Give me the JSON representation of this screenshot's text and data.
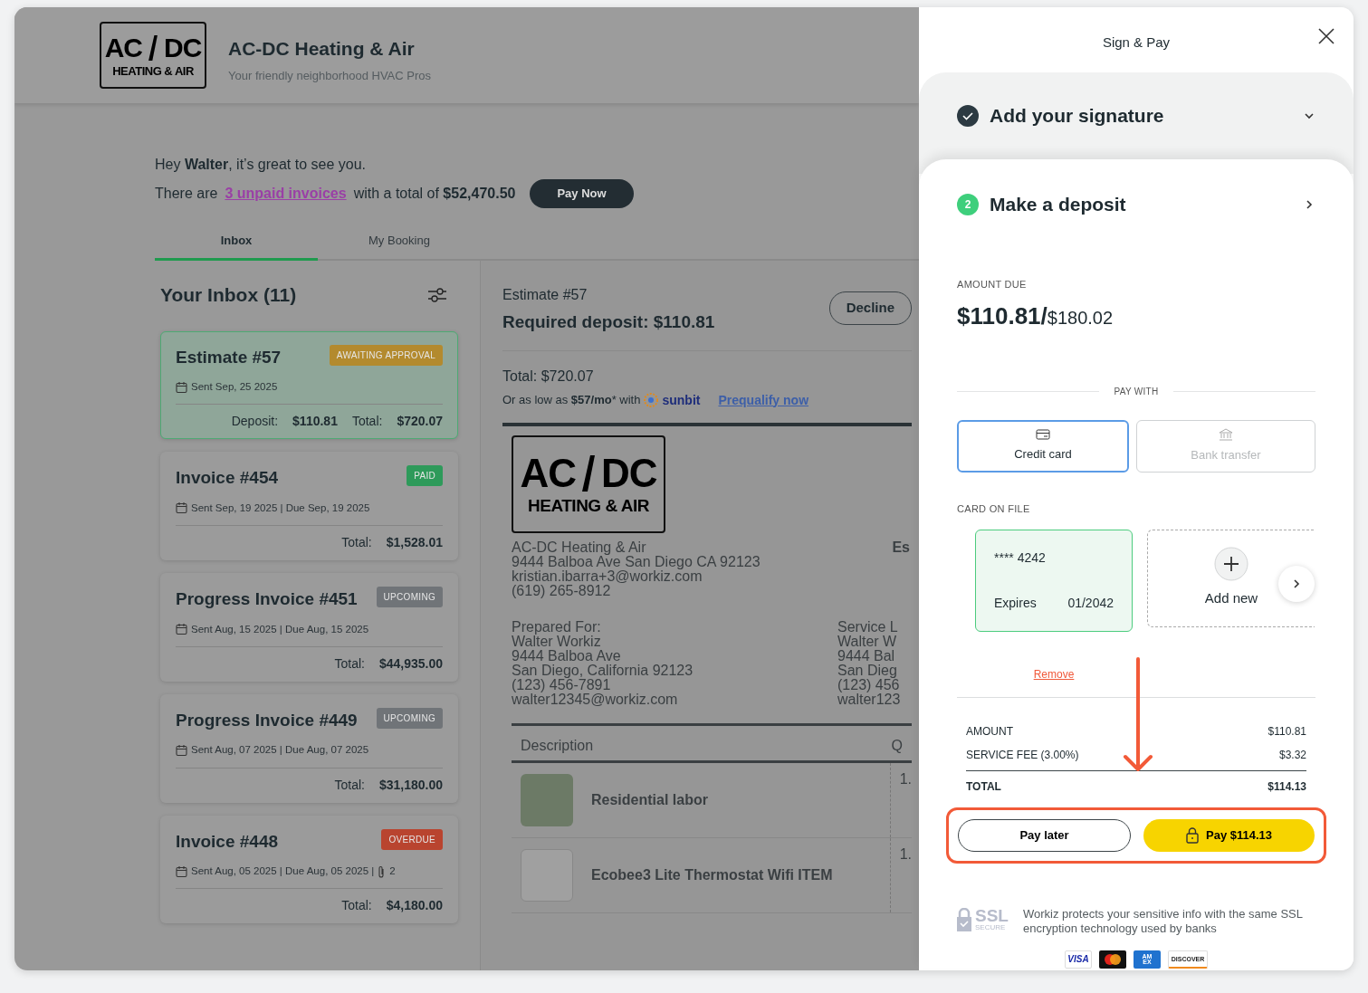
{
  "company": {
    "logo": {
      "left": "AC",
      "right": "DC",
      "tagline": "HEATING & AIR"
    },
    "name": "AC-DC Heating & Air",
    "slogan": "Your friendly neighborhood HVAC Pros"
  },
  "greeting": {
    "line": "Hey **Walter**, it’s great to see you.",
    "prefix": "There are",
    "unpaid_link": "3 unpaid invoices",
    "suffix": "with a total of **$52,470.50**",
    "button": "Pay Now"
  },
  "tabs": [
    {
      "label": "Inbox",
      "selected": true
    },
    {
      "label": "My Booking",
      "selected": false
    }
  ],
  "inbox": {
    "title": "Your Inbox (11)",
    "items": [
      {
        "title": "Estimate #57",
        "status": "AWAITING APPROVAL",
        "color": "#b38a2e",
        "selected": true,
        "meta": "Sent Sep, 25 2025",
        "totals": [
          {
            "label": "Deposit:",
            "value": "$110.81"
          },
          {
            "label": "Total:",
            "value": "$720.07"
          }
        ]
      },
      {
        "title": "Invoice #454",
        "status": "PAID",
        "color": "#2e9a5a",
        "selected": false,
        "meta": "Sent Sep, 19 2025 | Due Sep, 19 2025",
        "totals": [
          {
            "label": "Total:",
            "value": "$1,528.01"
          }
        ]
      },
      {
        "title": "Progress Invoice #451",
        "status": "UPCOMING",
        "color": "#707478",
        "selected": false,
        "meta": "Sent Aug, 15 2025 | Due Aug, 15 2025",
        "totals": [
          {
            "label": "Total:",
            "value": "$44,935.00"
          }
        ]
      },
      {
        "title": "Progress Invoice #449",
        "status": "UPCOMING",
        "color": "#707478",
        "selected": false,
        "meta": "Sent Aug, 07 2025 | Due Aug, 07 2025",
        "totals": [
          {
            "label": "Total:",
            "value": "$31,180.00"
          }
        ]
      },
      {
        "title": "Invoice #448",
        "status": "OVERDUE",
        "color": "#b9442f",
        "selected": false,
        "meta": "Sent Aug, 05 2025 | Due Aug, 05 2025 |",
        "attachments": "2",
        "totals": [
          {
            "label": "Total:",
            "value": "$4,180.00"
          }
        ]
      }
    ]
  },
  "estimate": {
    "number": "Estimate #57",
    "deposit": "Required deposit: $110.81",
    "decline": "Decline",
    "total": "Total: $720.07",
    "financing": "Or as low as **$57/mo*** with",
    "financer": "sunbit",
    "prequalify": "Prequalify now",
    "document": {
      "logo": {
        "left": "AC",
        "right": "DC",
        "tagline": "HEATING & AIR"
      },
      "company_lines": [
        "AC-DC Heating & Air",
        "9444 Balboa Ave San Diego CA 92123",
        "kristian.ibarra+3@workiz.com",
        "(619) 265-8912"
      ],
      "side_label": "Es",
      "prepared_for": {
        "title": "Prepared For:",
        "lines": [
          "Walter Workiz",
          "9444 Balboa Ave",
          "San Diego, California 92123",
          "(123) 456-7891",
          "walter12345@workiz.com"
        ]
      },
      "service_location": {
        "title": "Service L",
        "lines": [
          "Walter W",
          "9444 Bal",
          "San Dieg",
          "(123) 456",
          "walter123"
        ]
      },
      "columns": [
        "Description",
        "Q"
      ],
      "rows": [
        {
          "description": "Residential labor",
          "qty": "1."
        },
        {
          "description": "Ecobee3 Lite Thermostat Wifi ITEM",
          "qty": "1."
        }
      ]
    }
  },
  "drawer": {
    "title": "Sign & Pay",
    "steps": [
      {
        "title": "Add your signature",
        "done": true
      },
      {
        "number": "2",
        "title": "Make a deposit",
        "done": false
      }
    ],
    "amount_label": "AMOUNT DUE",
    "amount": "$110.81/",
    "amount_of": "$180.02",
    "pay_with": "PAY WITH",
    "methods": [
      {
        "kind": "card",
        "label": "Credit card",
        "selected": true
      },
      {
        "kind": "bank",
        "label": "Bank transfer",
        "selected": false
      }
    ],
    "card_on_file": "CARD ON FILE",
    "cards": [
      {
        "masked": "**** 4242",
        "expires_label": "Expires",
        "expires": "01/2042",
        "selected": true
      }
    ],
    "add_new": "Add new",
    "remove": "Remove",
    "summary": [
      {
        "label": "AMOUNT",
        "value": "$110.81"
      },
      {
        "label": "SERVICE FEE (3.00%)",
        "value": "$3.32"
      }
    ],
    "total": {
      "label": "TOTAL",
      "value": "$114.13"
    },
    "pay_later": "Pay later",
    "pay": "Pay $114.13",
    "ssl": {
      "title": "SSL",
      "subtitle": "SECURE"
    },
    "security_text": "Workiz protects your sensitive info with the same SSL encryption technology used by banks",
    "brands": [
      {
        "kind": "visa",
        "label": "VISA"
      },
      {
        "kind": "mastercard"
      },
      {
        "kind": "amex",
        "label": "AM EX"
      },
      {
        "kind": "discover",
        "label": "DISCOVER"
      }
    ]
  }
}
